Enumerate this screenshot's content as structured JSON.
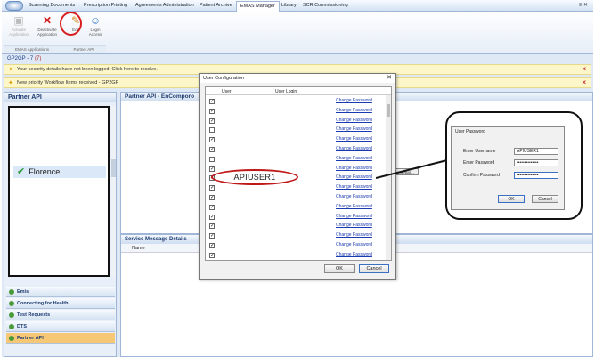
{
  "tabs": [
    "Scanning Documents",
    "Prescription Printing",
    "Agreements Administration",
    "Patient Archive",
    "EMAS Manager",
    "Library",
    "SCR Commissioning"
  ],
  "active_tab": "EMAS Manager",
  "window_controls": "≡ ✕",
  "ribbon": {
    "buttons": [
      {
        "label": "Activate Application",
        "icon": "activate-icon"
      },
      {
        "label": "Deactivate Application",
        "icon": "deactivate-icon"
      },
      {
        "label": "Edit",
        "icon": "edit-icon"
      },
      {
        "label": "Login Access",
        "icon": "login-access-icon"
      }
    ],
    "groups": [
      "EMAS Applications",
      "Partner API"
    ]
  },
  "breadcrumb": {
    "text": "GP2GP",
    "count": "- 7",
    "bracket": "(7)"
  },
  "notifications": [
    "Your security details have not been logged.  Click here to resolve.",
    "New priority Workflow Items received - GP2GP"
  ],
  "left_panel": {
    "title": "Partner API",
    "selected_item": "Florence",
    "nav": [
      "Emis",
      "Connecting for Health",
      "Test Requests",
      "DTS",
      "Partner API"
    ]
  },
  "main": {
    "title": "Partner API - EnComporo",
    "bg_button": "Setup..."
  },
  "service_panel": {
    "title": "Service Message Details",
    "column": "Name"
  },
  "dialog": {
    "title": "User Configuration",
    "col_user": "User",
    "col_login": "User Login",
    "link_label": "Change Password",
    "rows": [
      true,
      true,
      true,
      false,
      true,
      true,
      false,
      true,
      true,
      true,
      true,
      true,
      true,
      true,
      true,
      true,
      true
    ],
    "ok": "OK",
    "cancel": "Cancel",
    "close": "✕"
  },
  "annotation": {
    "user_login": "APIUSER1"
  },
  "password_dialog": {
    "title": "User Password",
    "username_label": "Enter Username",
    "username_value": "APIUSER1",
    "password_label": "Enter Password",
    "password_value": "••••••••••••••",
    "confirm_label": "Confirm Password",
    "confirm_value": "••••••••••••••",
    "ok": "OK",
    "cancel": "Cancel"
  }
}
